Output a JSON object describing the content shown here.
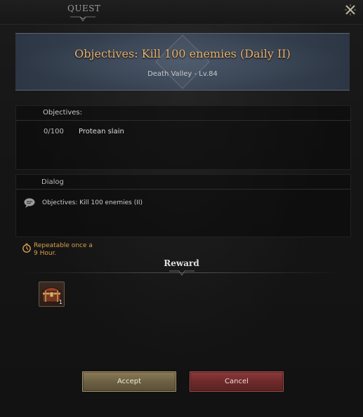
{
  "window": {
    "title": "QUEST",
    "close_icon": "close-x-icon"
  },
  "banner": {
    "title": "Objectives: Kill 100 enemies (Daily II)",
    "subtitle": "Death Valley - Lv.84"
  },
  "objectives": {
    "label": "Objectives:",
    "items": [
      {
        "progress": "0/100",
        "text": "Protean slain"
      }
    ]
  },
  "dialog": {
    "label": "Dialog",
    "icon": "speech-bubble-icon",
    "text": "Objectives: Kill 100 enemies (II)"
  },
  "repeat": {
    "icon": "stopwatch-icon",
    "text": "Repeatable once a 9 Hour."
  },
  "reward": {
    "title": "Reward",
    "items": [
      {
        "icon": "treasure-chest-icon",
        "quantity": "1"
      }
    ]
  },
  "buttons": {
    "accept": "Accept",
    "cancel": "Cancel"
  },
  "colors": {
    "title_gold": "#e9b06a",
    "repeat_gold": "#d8a24a",
    "accept_bg": "#6d6144",
    "cancel_bg": "#6e2a2a"
  }
}
